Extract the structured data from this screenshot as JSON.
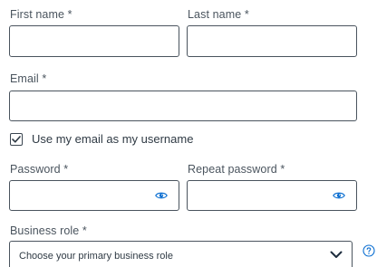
{
  "form": {
    "first_name": {
      "label": "First name *",
      "value": "",
      "placeholder": ""
    },
    "last_name": {
      "label": "Last name *",
      "value": "",
      "placeholder": ""
    },
    "email": {
      "label": "Email *",
      "value": "",
      "placeholder": ""
    },
    "use_email_as_username": {
      "label": "Use my email as my username",
      "checked": true
    },
    "password": {
      "label": "Password *",
      "value": ""
    },
    "repeat_password": {
      "label": "Repeat password *",
      "value": ""
    },
    "business_role": {
      "label": "Business role *",
      "selected": "Choose your primary business role"
    }
  },
  "icons": {
    "eye": "eye-icon",
    "chevron": "chevron-down-icon",
    "help": "question-mark-circle-icon",
    "check": "checkmark-icon"
  },
  "colors": {
    "accent": "#0a6ed1",
    "border": "#4a545e",
    "text": "#2f3a44"
  }
}
